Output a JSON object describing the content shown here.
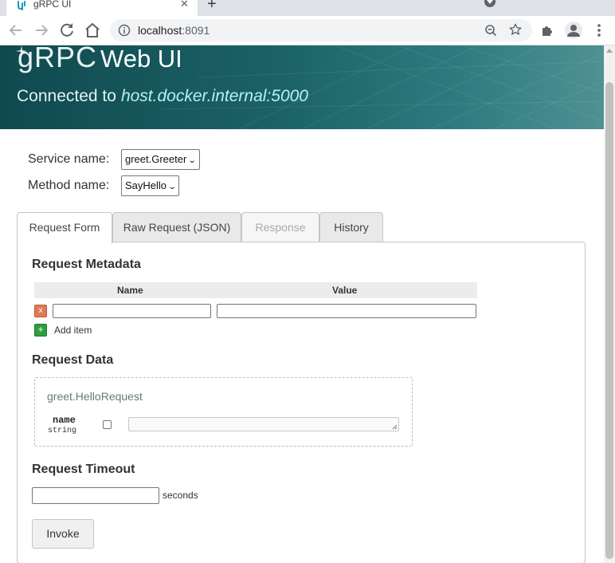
{
  "browser": {
    "tab_title": "gRPC UI",
    "new_tab": "+",
    "tab_close": "✕",
    "url_host": "localhost",
    "url_port": ":8091"
  },
  "header": {
    "logo_text": "gRPC",
    "title": "Web UI",
    "connected_label": "Connected to",
    "connected_host": "host.docker.internal:5000"
  },
  "selectors": {
    "service_label": "Service name:",
    "service_value": "greet.Greeter",
    "method_label": "Method name:",
    "method_value": "SayHello"
  },
  "tabs": [
    {
      "label": "Request Form",
      "state": "active"
    },
    {
      "label": "Raw Request (JSON)",
      "state": "normal"
    },
    {
      "label": "Response",
      "state": "disabled"
    },
    {
      "label": "History",
      "state": "normal"
    }
  ],
  "request_form": {
    "metadata_title": "Request Metadata",
    "metadata_columns": [
      "Name",
      "Value"
    ],
    "remove_glyph": "x",
    "add_glyph": "+",
    "add_item_label": "Add item",
    "data_title": "Request Data",
    "message_type": "greet.HelloRequest",
    "field_name": "name",
    "field_type": "string",
    "timeout_title": "Request Timeout",
    "timeout_unit": "seconds",
    "invoke_label": "Invoke"
  },
  "colors": {
    "header_dark": "#0f4a4f",
    "header_light": "#4f9194",
    "add_button": "#2e9e3e",
    "remove_button": "#e07b58"
  }
}
